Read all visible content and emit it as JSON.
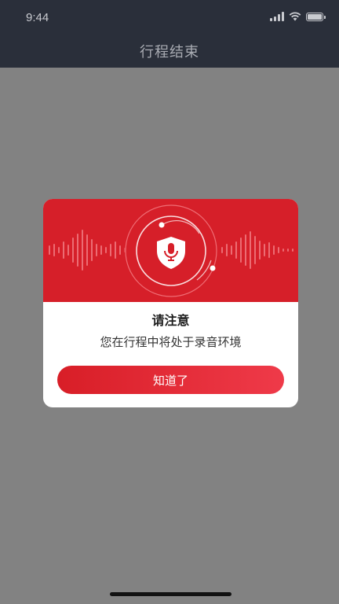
{
  "status_bar": {
    "time": "9:44",
    "signal_icon": "signal-bars-icon",
    "wifi_icon": "wifi-icon",
    "battery_icon": "battery-icon"
  },
  "nav": {
    "title": "行程结束"
  },
  "dialog": {
    "banner_icon": "microphone-shield-icon",
    "title": "请注意",
    "message": "您在行程中将处于录音环境",
    "confirm_label": "知道了"
  },
  "colors": {
    "accent": "#d61f29",
    "header_bg": "#2a2f3a",
    "overlay": "#828282"
  }
}
